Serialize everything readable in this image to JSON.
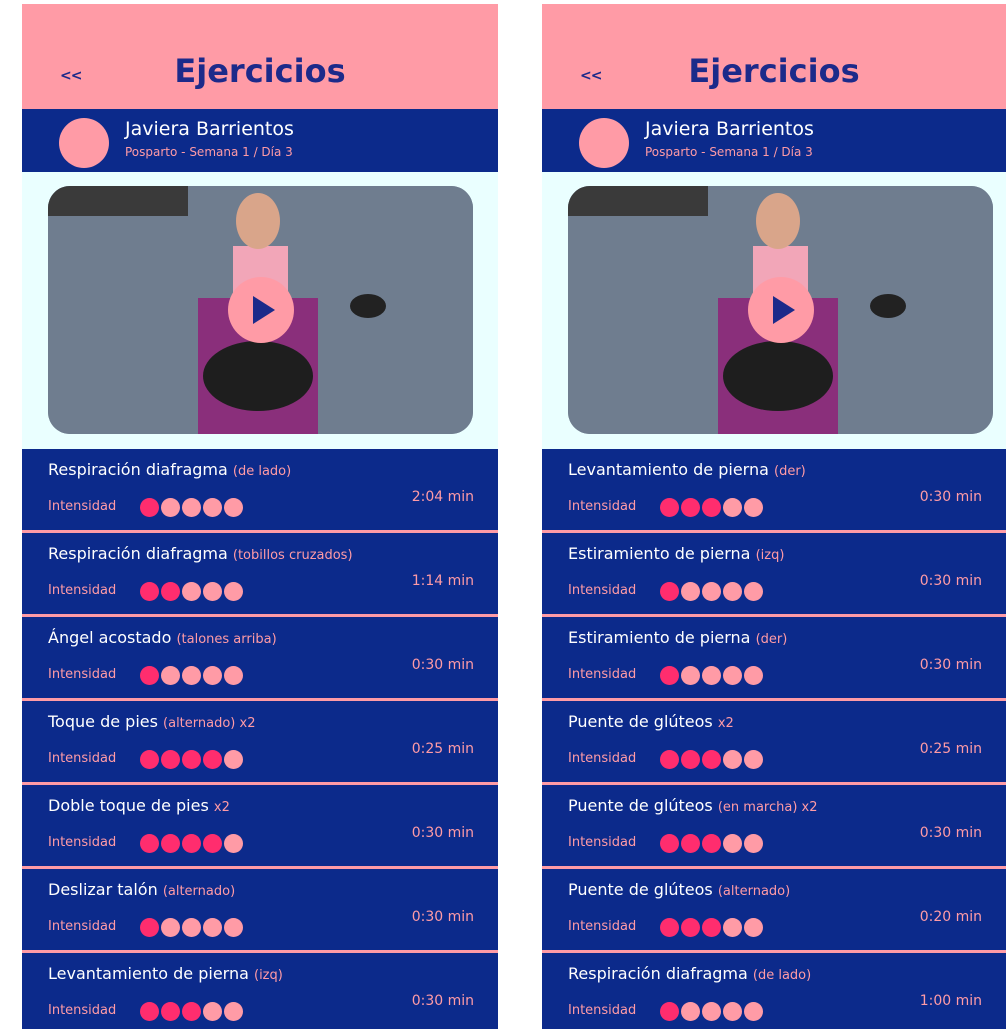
{
  "screens": [
    {
      "header": {
        "back_label": "<<",
        "title": "Ejercicios"
      },
      "user": {
        "name": "Javiera Barrientos",
        "subtitle": "Posparto - Semana 1 / Día 3"
      },
      "intensity_label": "Intensidad",
      "exercises": [
        {
          "name": "Respiración diafragma",
          "extra": "(de lado)",
          "intensity": 1,
          "time": "2:04 min"
        },
        {
          "name": "Respiración diafragma",
          "extra": "(tobillos cruzados)",
          "intensity": 2,
          "time": "1:14 min"
        },
        {
          "name": "Ángel acostado",
          "extra": "(talones arriba)",
          "intensity": 1,
          "time": "0:30 min"
        },
        {
          "name": "Toque de pies",
          "extra": "(alternado) x2",
          "intensity": 4,
          "time": "0:25 min"
        },
        {
          "name": "Doble toque de pies",
          "extra": "x2",
          "intensity": 4,
          "time": "0:30 min"
        },
        {
          "name": "Deslizar talón",
          "extra": "(alternado)",
          "intensity": 1,
          "time": "0:30 min"
        },
        {
          "name": "Levantamiento de pierna",
          "extra": "(izq)",
          "intensity": 3,
          "time": "0:30 min"
        }
      ]
    },
    {
      "header": {
        "back_label": "<<",
        "title": "Ejercicios"
      },
      "user": {
        "name": "Javiera Barrientos",
        "subtitle": "Posparto - Semana 1 / Día 3"
      },
      "intensity_label": "Intensidad",
      "exercises": [
        {
          "name": "Levantamiento de pierna",
          "extra": "(der)",
          "intensity": 3,
          "time": "0:30 min"
        },
        {
          "name": "Estiramiento de pierna",
          "extra": "(izq)",
          "intensity": 1,
          "time": "0:30 min"
        },
        {
          "name": "Estiramiento de pierna",
          "extra": "(der)",
          "intensity": 1,
          "time": "0:30 min"
        },
        {
          "name": "Puente de glúteos",
          "extra": "x2",
          "intensity": 3,
          "time": "0:25 min"
        },
        {
          "name": "Puente de glúteos",
          "extra": "(en marcha) x2",
          "intensity": 3,
          "time": "0:30 min"
        },
        {
          "name": "Puente de glúteos",
          "extra": "(alternado)",
          "intensity": 3,
          "time": "0:20 min"
        },
        {
          "name": "Respiración diafragma",
          "extra": "(de lado)",
          "intensity": 1,
          "time": "1:00 min"
        }
      ]
    }
  ],
  "colors": {
    "header_pink": "#ff9ba6",
    "navy": "#0c2a8b",
    "active_dot": "#ff2d6e",
    "background": "#eaffff"
  }
}
